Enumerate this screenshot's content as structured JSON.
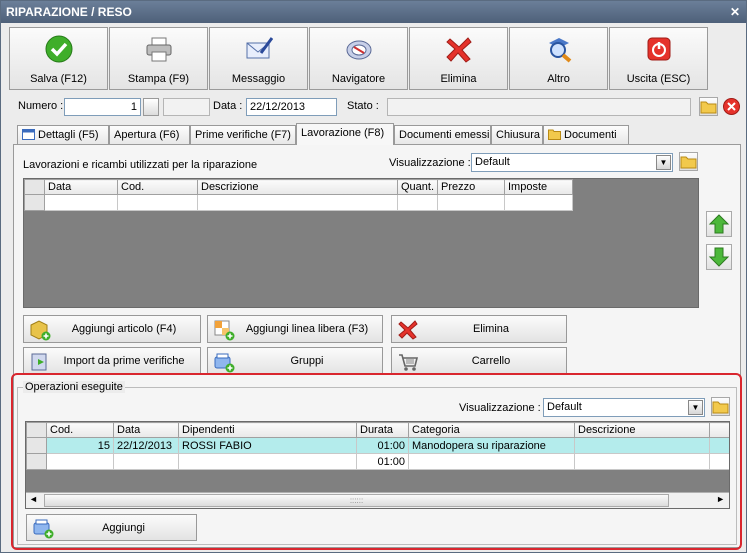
{
  "window": {
    "title": "RIPARAZIONE / RESO",
    "close_glyph": "✕"
  },
  "toolbar": [
    {
      "label": "Salva (F12)",
      "icon": "check-icon"
    },
    {
      "label": "Stampa (F9)",
      "icon": "printer-icon"
    },
    {
      "label": "Messaggio",
      "icon": "envelope-pen-icon"
    },
    {
      "label": "Navigatore",
      "icon": "compass-icon"
    },
    {
      "label": "Elimina",
      "icon": "red-x-icon"
    },
    {
      "label": "Altro",
      "icon": "magnifier-icon"
    },
    {
      "label": "Uscita (ESC)",
      "icon": "power-icon"
    }
  ],
  "header": {
    "numero_label": "Numero :",
    "numero_value": "1",
    "data_label": "Data :",
    "data_value": "22/12/2013",
    "stato_label": "Stato :",
    "stato_value": ""
  },
  "tabs": [
    {
      "label": "Dettagli (F5)",
      "icon": "calendar-icon"
    },
    {
      "label": "Apertura (F6)"
    },
    {
      "label": "Prime verifiche (F7)"
    },
    {
      "label": "Lavorazione (F8)",
      "active": true
    },
    {
      "label": "Documenti emessi"
    },
    {
      "label": "Chiusura"
    },
    {
      "label": "Documenti",
      "icon": "folder-icon"
    }
  ],
  "lavorazione": {
    "caption": "Lavorazioni e ricambi utilizzati per la riparazione",
    "view_label": "Visualizzazione :",
    "view_value": "Default",
    "columns": [
      "Data",
      "Cod.",
      "Descrizione",
      "Quant.",
      "Prezzo",
      "Imposte"
    ],
    "rows": []
  },
  "actions": {
    "aggiungi_articolo": "Aggiungi articolo (F4)",
    "aggiungi_linea": "Aggiungi linea libera (F3)",
    "elimina": "Elimina",
    "import_prime": "Import da prime verifiche",
    "gruppi": "Gruppi",
    "carrello": "Carrello"
  },
  "operazioni": {
    "legend": "Operazioni eseguite",
    "view_label": "Visualizzazione :",
    "view_value": "Default",
    "columns": [
      "Cod.",
      "Data",
      "Dipendenti",
      "Durata",
      "Categoria",
      "Descrizione"
    ],
    "rows": [
      {
        "cod": "15",
        "data": "22/12/2013",
        "dipendenti": "ROSSI FABIO",
        "durata": "01:00",
        "categoria": "Manodopera su riparazione",
        "descrizione": ""
      },
      {
        "cod": "",
        "data": "",
        "dipendenti": "",
        "durata": "01:00",
        "categoria": "",
        "descrizione": ""
      }
    ],
    "add_label": "Aggiungi",
    "scroll_grip": "::::::"
  },
  "colors": {
    "highlight_border": "#d9262e",
    "selected_row": "#b4ecec",
    "title_bar": "#5a6d87"
  }
}
